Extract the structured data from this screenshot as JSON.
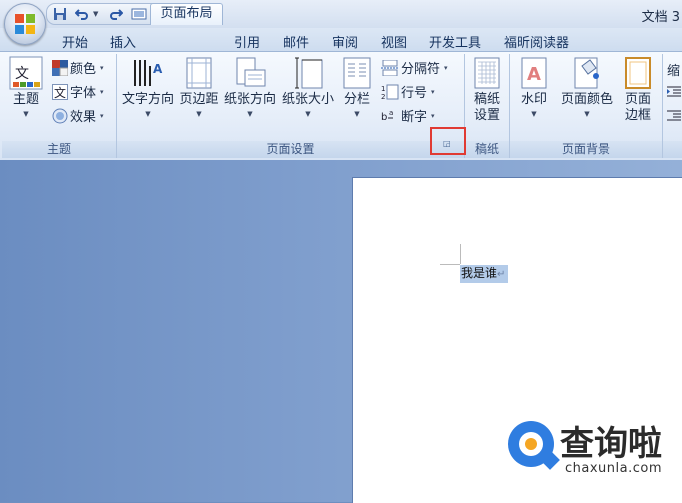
{
  "title_bar": {
    "doc_title": "文档 3"
  },
  "tabs": [
    "开始",
    "插入",
    "页面布局",
    "引用",
    "邮件",
    "审阅",
    "视图",
    "开发工具",
    "福昕阅读器"
  ],
  "active_tab": "页面布局",
  "ribbon": {
    "theme_group": {
      "label": "主题",
      "theme_button": "主题",
      "colors": "颜色",
      "fonts": "字体",
      "effects": "效果"
    },
    "page_setup_group": {
      "label": "页面设置",
      "text_direction": "文字方向",
      "margins": "页边距",
      "orientation": "纸张方向",
      "size": "纸张大小",
      "columns": "分栏",
      "breaks": "分隔符",
      "line_numbers": "行号",
      "hyphenation": "断字"
    },
    "manuscript_group": {
      "label": "稿纸",
      "settings_line1": "稿纸",
      "settings_line2": "设置"
    },
    "page_background_group": {
      "label": "页面背景",
      "watermark": "水印",
      "page_color": "页面颜色",
      "borders_line1": "页面",
      "borders_line2": "边框"
    },
    "paragraph_partial": {
      "label_fragment": "缩"
    }
  },
  "document": {
    "text": "我是谁"
  },
  "watermark": {
    "brand": "查询啦",
    "url": "chaxunla.com"
  },
  "colors": {
    "highlight_box": "#e03a33",
    "selection": "#b3cbe9",
    "watermark_blue": "#2f7de0"
  }
}
